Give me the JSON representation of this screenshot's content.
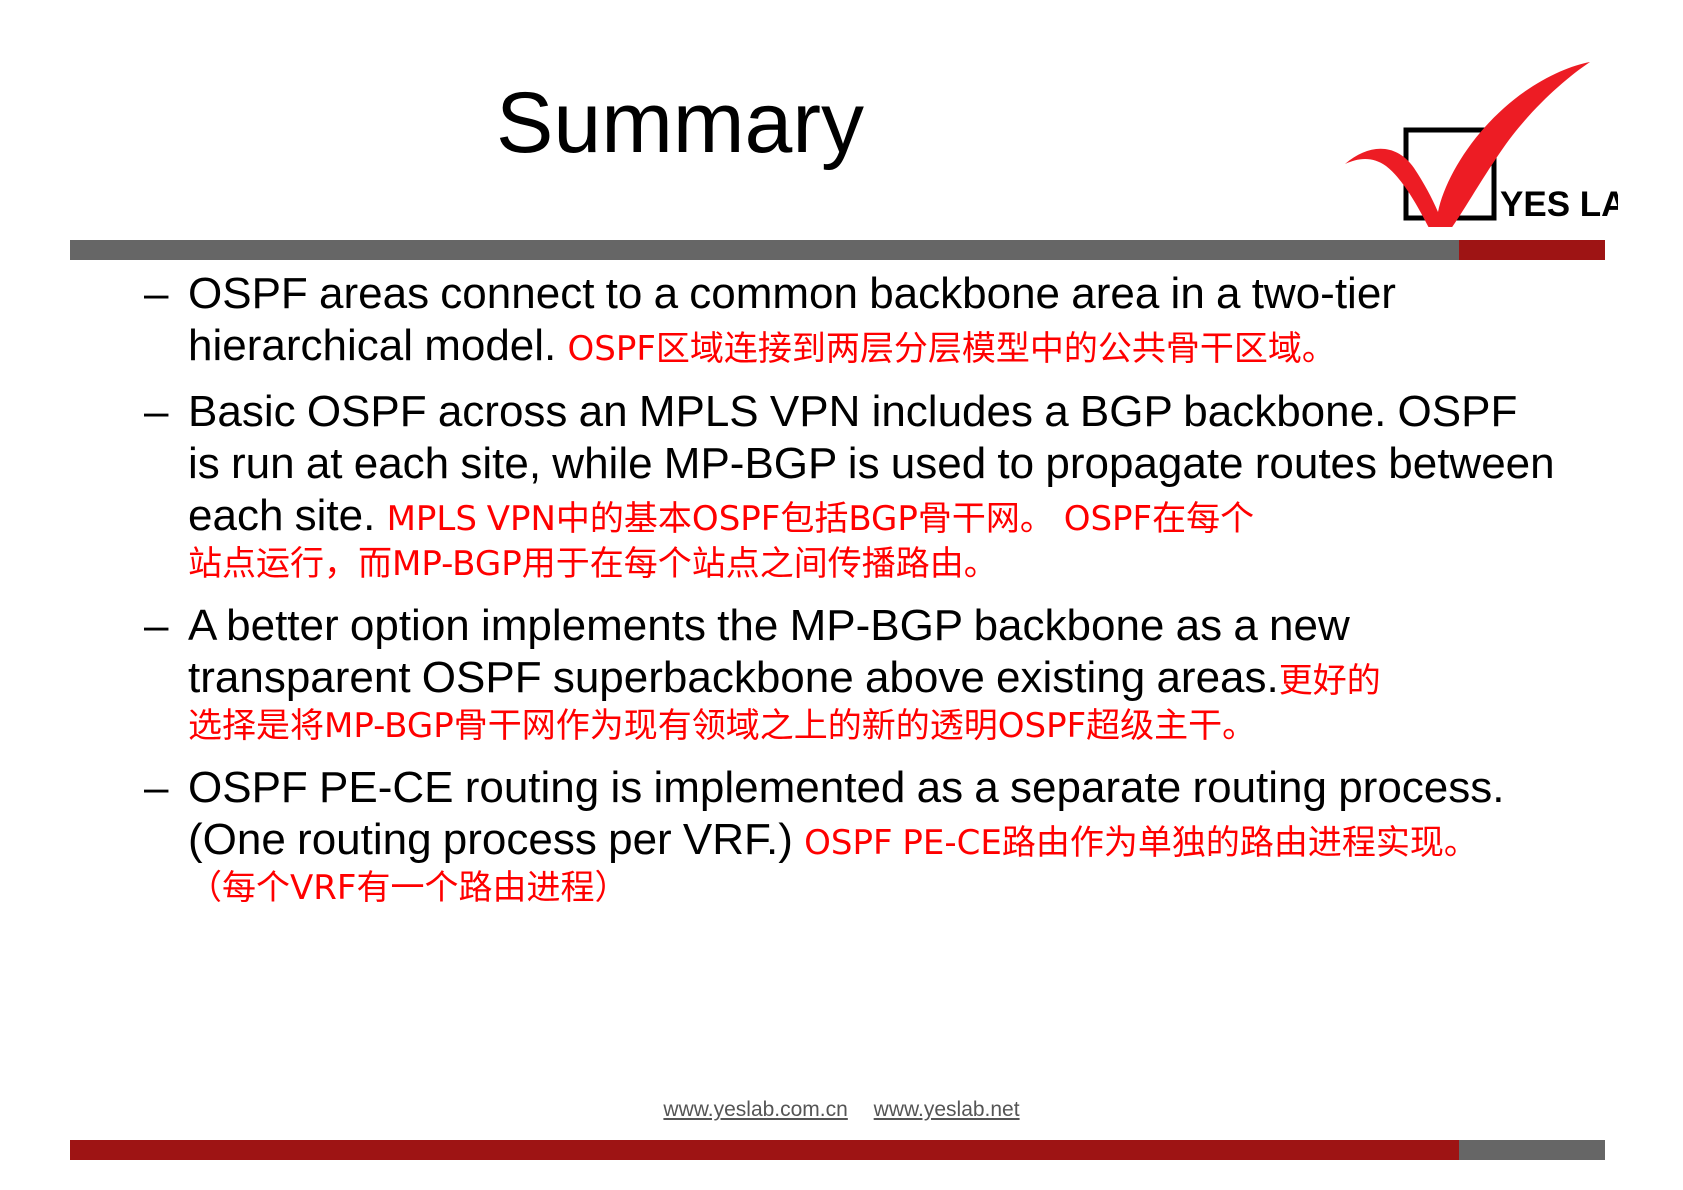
{
  "slide": {
    "title": "Summary",
    "logo": {
      "name": "yes-lab-logo",
      "text": "YES LAB",
      "check_color": "#ED1C24",
      "box_color": "#000000"
    },
    "colors": {
      "header_bar_gray": "#666666",
      "header_bar_red": "#9E1414",
      "footer_bar_red": "#9E1414",
      "footer_bar_gray": "#666666",
      "body_text": "#000000",
      "translation_text": "#FF0000"
    },
    "bullets": [
      {
        "marker": "–",
        "en": "OSPF areas connect to a common backbone area in a two-tier hierarchical model. ",
        "cn": "OSPF区域连接到两层分层模型中的公共骨干区域。",
        "cn_extra": ""
      },
      {
        "marker": "–",
        "en": "Basic OSPF across an MPLS VPN includes a BGP backbone. OSPF is run at each site, while MP-BGP is used to propagate routes between each site. ",
        "cn": "MPLS VPN中的基本OSPF包括BGP骨干网。 OSPF在每个",
        "cn_extra": "站点运行，而MP-BGP用于在每个站点之间传播路由。"
      },
      {
        "marker": "–",
        "en": "A better option implements the MP-BGP backbone as a new transparent OSPF superbackbone above existing areas.",
        "cn": "更好的",
        "cn_extra": "选择是将MP-BGP骨干网作为现有领域之上的新的透明OSPF超级主干。"
      },
      {
        "marker": "–",
        "en": "OSPF PE-CE routing is implemented as a separate routing process. (One routing process per VRF.) ",
        "cn": "OSPF PE-CE路由作为单独的路由进程实现。",
        "cn_extra": "（每个VRF有一个路由进程）"
      }
    ],
    "footer": {
      "link1": "www.yeslab.com.cn",
      "link2": "www.yeslab.net"
    }
  }
}
